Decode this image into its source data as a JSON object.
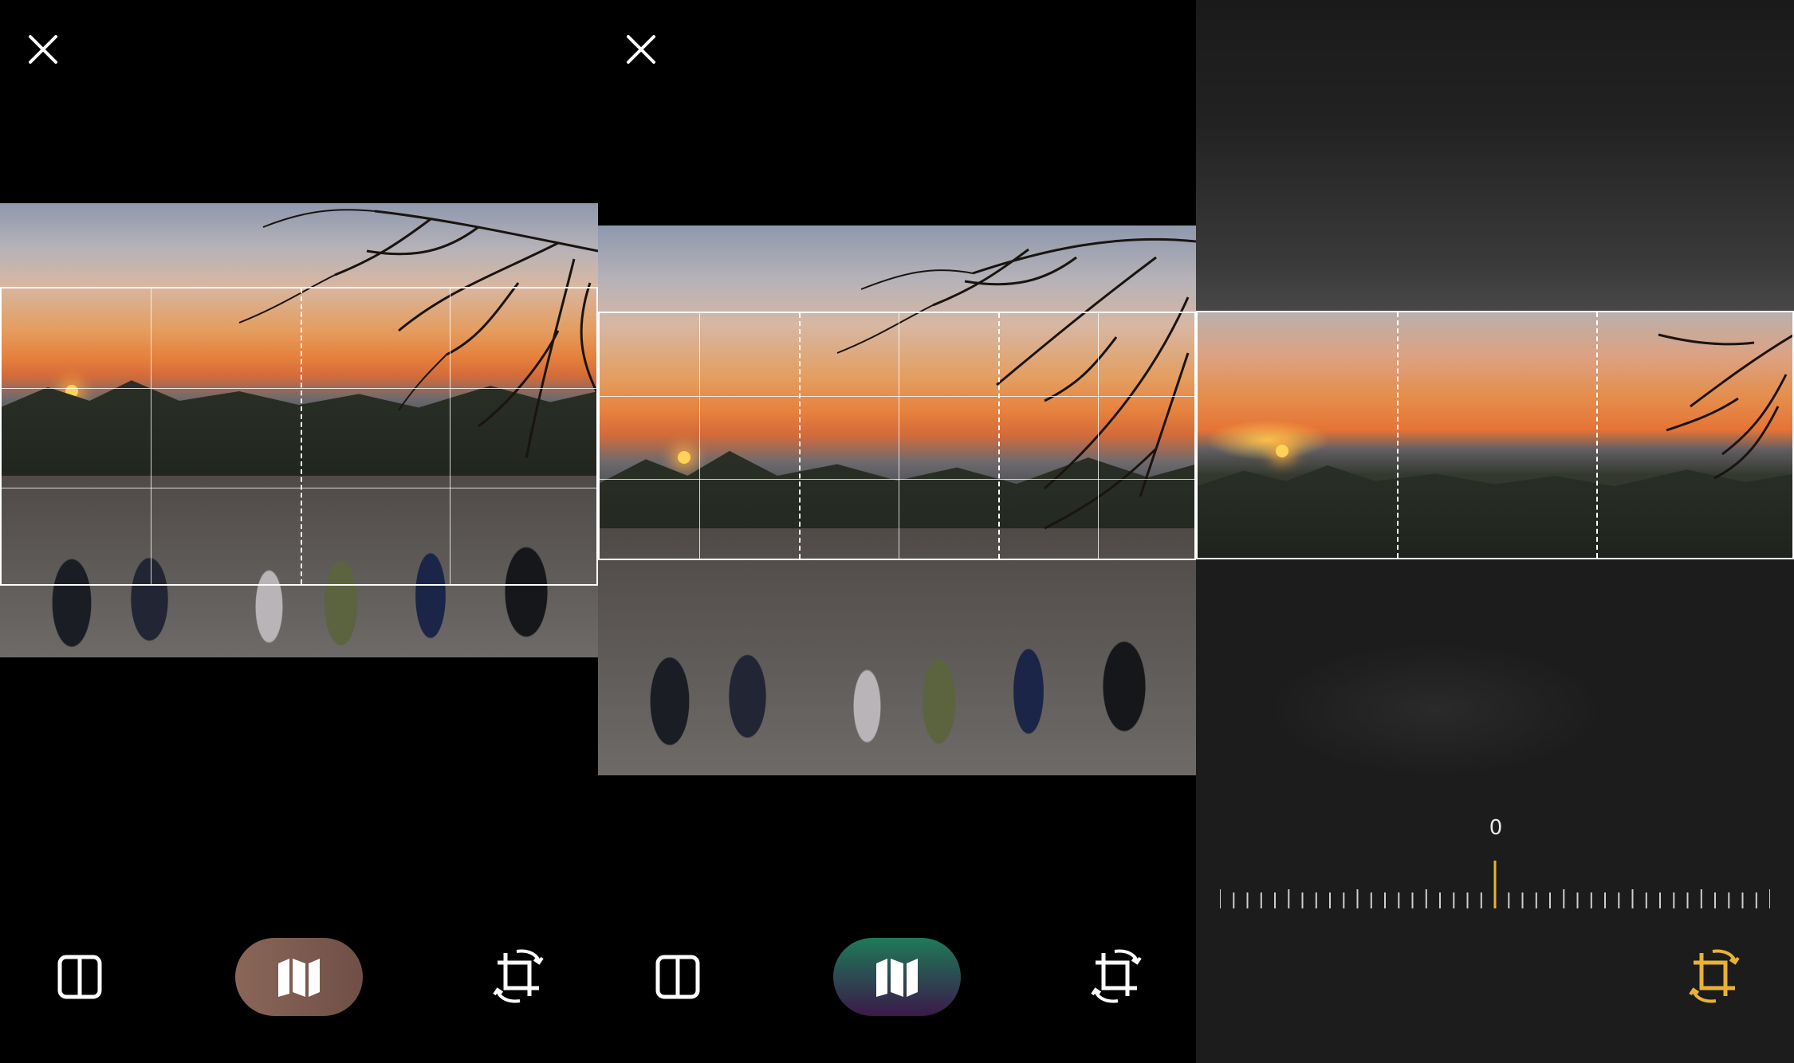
{
  "panels": [
    {
      "id": "panel-1",
      "close_icon": "close-icon",
      "toolbar": {
        "split_icon": "split-view-icon",
        "map_icon": "map-icon",
        "map_pill_color": "#7a5a50",
        "crop_icon": "crop-rotate-icon"
      }
    },
    {
      "id": "panel-2",
      "close_icon": "close-icon",
      "toolbar": {
        "split_icon": "split-view-icon",
        "map_icon": "map-icon",
        "map_pill_gradient": [
          "#1f7a58",
          "#3a1a4a"
        ],
        "crop_icon": "crop-rotate-icon"
      }
    },
    {
      "id": "panel-3",
      "rotation_angle": "0",
      "crop_icon": "crop-rotate-icon",
      "crop_icon_color": "#e9b234"
    }
  ],
  "colors": {
    "accent": "#e9b234",
    "frame": "#ffffff",
    "background": "#000000"
  }
}
